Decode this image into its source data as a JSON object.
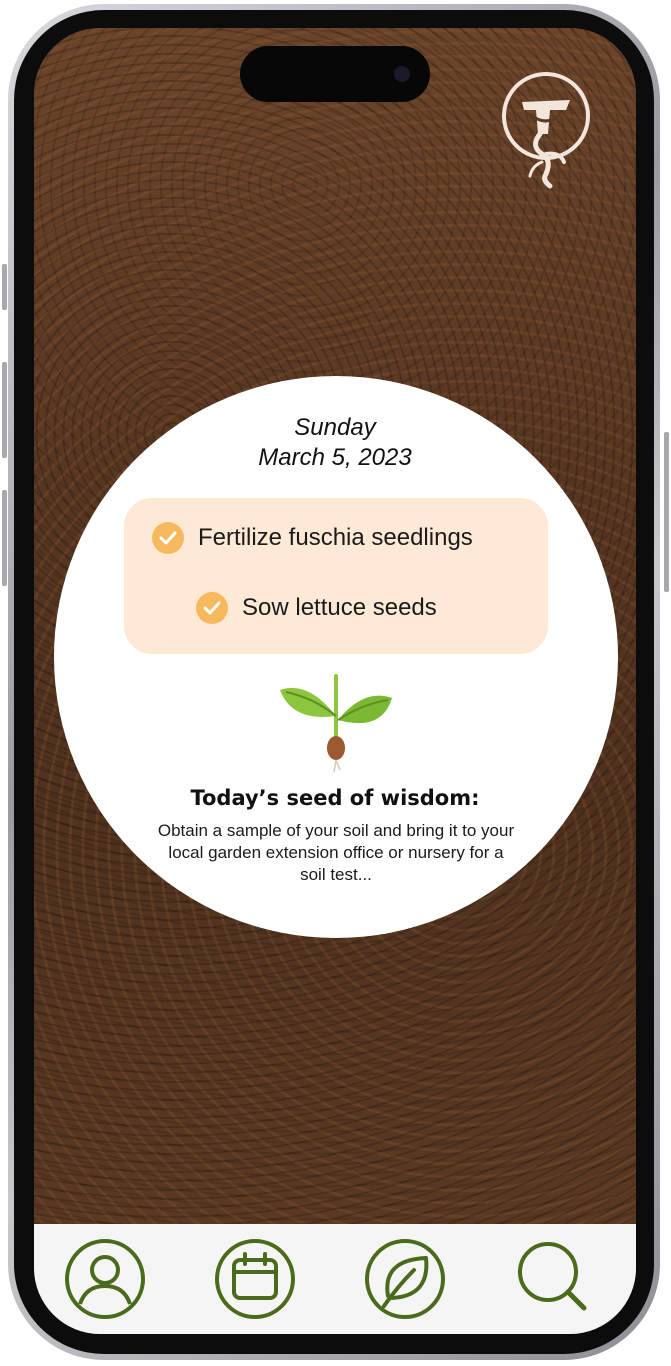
{
  "colors": {
    "accent_green": "#4a6b1c",
    "task_bg": "#fde9d6",
    "check": "#f6b95e",
    "soil": "#5a3a24"
  },
  "header": {
    "logo_icon": "gardener-logo-icon"
  },
  "date": {
    "day": "Sunday",
    "full": "March 5, 2023"
  },
  "tasks": [
    {
      "label": "Fertilize fuschia seedlings",
      "done": true
    },
    {
      "label": "Sow lettuce seeds",
      "done": true
    }
  ],
  "wisdom": {
    "icon": "seedling-icon",
    "title": "Today’s seed of wisdom:",
    "body": "Obtain a sample of your soil and bring it to your local garden extension office or nursery for a soil test..."
  },
  "nav": [
    {
      "icon": "profile-icon"
    },
    {
      "icon": "calendar-icon"
    },
    {
      "icon": "leaf-icon"
    },
    {
      "icon": "search-icon"
    }
  ]
}
